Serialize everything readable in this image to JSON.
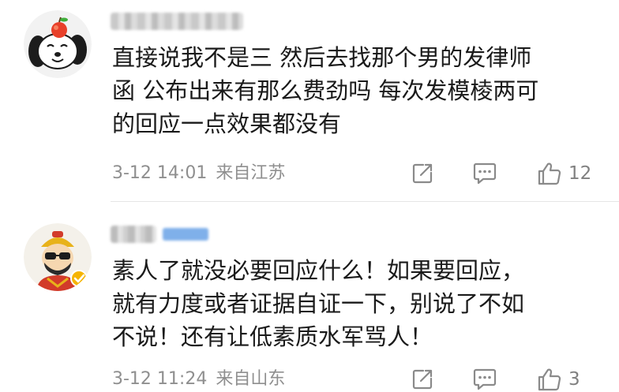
{
  "comments": [
    {
      "text": "直接说我不是三 然后去找那个男的发律师\n函 公布出来有那么费劲吗 每次发模棱两可\n的回应一点效果都没有",
      "time": "3-12 14:01",
      "location": "来自江苏",
      "likes": "12",
      "avatar_icon": "cartoon-dog-with-apple-icon"
    },
    {
      "text": "素人了就没必要回应什么！如果要回应，\n就有力度或者证据自证一下，别说了不如\n不说！还有让低素质水军骂人！",
      "time": "3-12 11:24",
      "location": "来自山东",
      "likes": "3",
      "avatar_icon": "cartoon-character-verified-avatar-icon"
    }
  ],
  "colors": {
    "text": "#1a1a1a",
    "meta": "#8f8f8f",
    "verified_badge": "#f5b400",
    "divider": "#e6e6e6"
  }
}
